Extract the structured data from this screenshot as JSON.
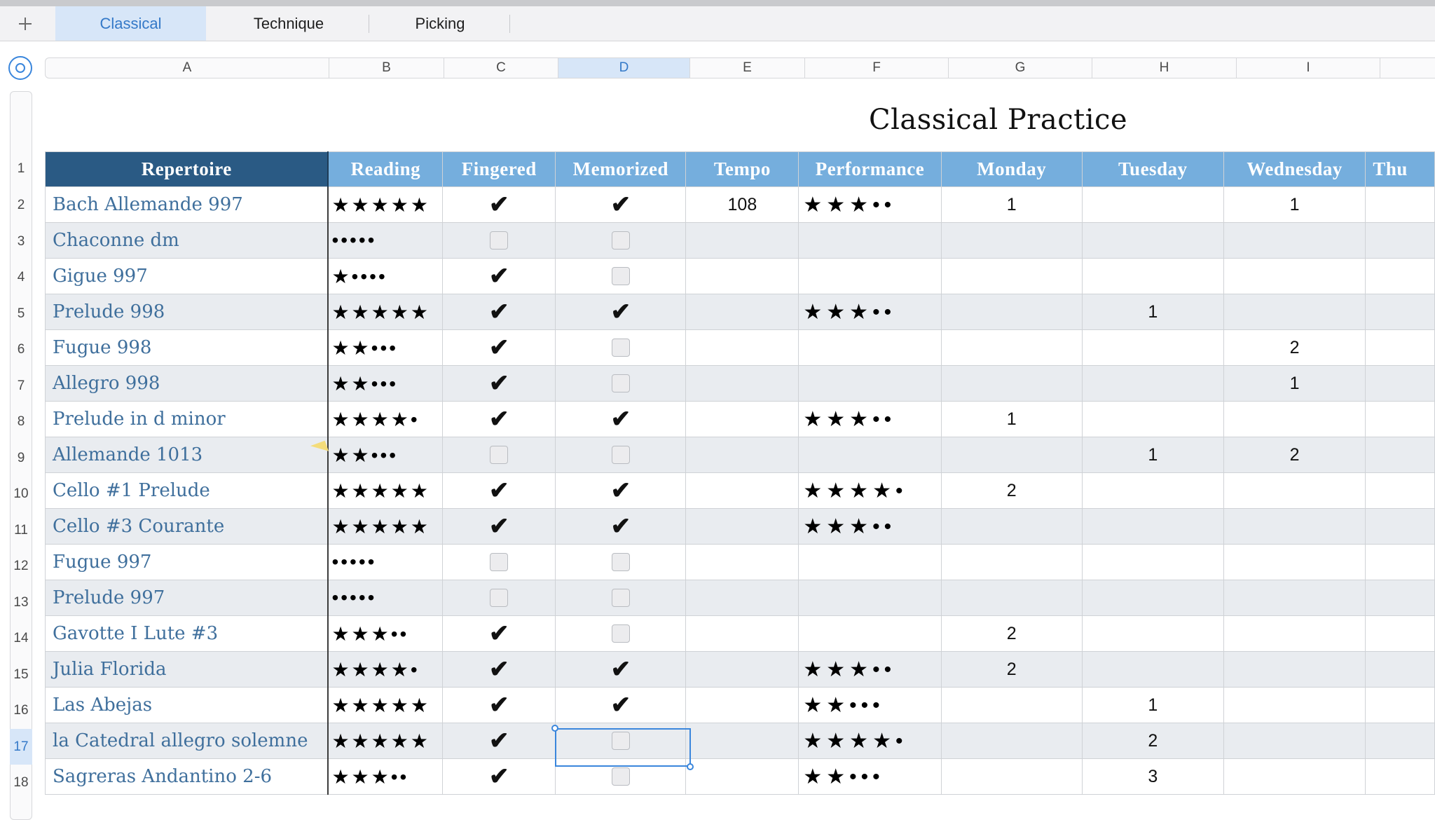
{
  "tabs": [
    {
      "label": "Classical",
      "active": true
    },
    {
      "label": "Technique",
      "active": false
    },
    {
      "label": "Picking",
      "active": false
    }
  ],
  "icons": {
    "add": "plus-icon",
    "select_all": "select-all-circle-icon"
  },
  "column_letters": [
    "A",
    "B",
    "C",
    "D",
    "E",
    "F",
    "G",
    "H",
    "I"
  ],
  "selected_column": "D",
  "row_numbers": [
    "1",
    "2",
    "3",
    "4",
    "5",
    "6",
    "7",
    "8",
    "9",
    "10",
    "11",
    "12",
    "13",
    "14",
    "15",
    "16",
    "17",
    "18"
  ],
  "selected_row": "17",
  "sheet_title": "Classical Practice",
  "table": {
    "headers": [
      "Repertoire",
      "Reading",
      "Fingered",
      "Memorized",
      "Tempo",
      "Performance",
      "Monday",
      "Tuesday",
      "Wednesday",
      "Thu"
    ],
    "rows": [
      {
        "name": "Bach Allemande 997",
        "reading": "★★★★★",
        "fingered": true,
        "memorized": true,
        "tempo": "108",
        "performance": "★★★••",
        "monday": "1",
        "tuesday": "",
        "wednesday": "1"
      },
      {
        "name": "Chaconne dm",
        "reading": "•••••",
        "fingered": false,
        "memorized": false,
        "tempo": "",
        "performance": "",
        "monday": "",
        "tuesday": "",
        "wednesday": ""
      },
      {
        "name": "Gigue 997",
        "reading": "★••••",
        "fingered": true,
        "memorized": false,
        "tempo": "",
        "performance": "",
        "monday": "",
        "tuesday": "",
        "wednesday": ""
      },
      {
        "name": "Prelude 998",
        "reading": "★★★★★",
        "fingered": true,
        "memorized": true,
        "tempo": "",
        "performance": "★★★••",
        "monday": "",
        "tuesday": "1",
        "wednesday": ""
      },
      {
        "name": "Fugue 998",
        "reading": "★★•••",
        "fingered": true,
        "memorized": false,
        "tempo": "",
        "performance": "",
        "monday": "",
        "tuesday": "",
        "wednesday": "2"
      },
      {
        "name": "Allegro 998",
        "reading": "★★•••",
        "fingered": true,
        "memorized": false,
        "tempo": "",
        "performance": "",
        "monday": "",
        "tuesday": "",
        "wednesday": "1"
      },
      {
        "name": "Prelude in d minor",
        "reading": "★★★★•",
        "fingered": true,
        "memorized": true,
        "tempo": "",
        "performance": "★★★••",
        "monday": "1",
        "tuesday": "",
        "wednesday": ""
      },
      {
        "name": "Allemande 1013",
        "reading": "★★•••",
        "fingered": false,
        "memorized": false,
        "tempo": "",
        "performance": "",
        "monday": "",
        "tuesday": "1",
        "wednesday": "2"
      },
      {
        "name": "Cello #1 Prelude",
        "reading": "★★★★★",
        "fingered": true,
        "memorized": true,
        "tempo": "",
        "performance": "★★★★•",
        "monday": "2",
        "tuesday": "",
        "wednesday": ""
      },
      {
        "name": "Cello #3 Courante",
        "reading": "★★★★★",
        "fingered": true,
        "memorized": true,
        "tempo": "",
        "performance": "★★★••",
        "monday": "",
        "tuesday": "",
        "wednesday": ""
      },
      {
        "name": "Fugue 997",
        "reading": "•••••",
        "fingered": false,
        "memorized": false,
        "tempo": "",
        "performance": "",
        "monday": "",
        "tuesday": "",
        "wednesday": ""
      },
      {
        "name": "Prelude 997",
        "reading": "•••••",
        "fingered": false,
        "memorized": false,
        "tempo": "",
        "performance": "",
        "monday": "",
        "tuesday": "",
        "wednesday": ""
      },
      {
        "name": "Gavotte I Lute #3",
        "reading": "★★★••",
        "fingered": true,
        "memorized": false,
        "tempo": "",
        "performance": "",
        "monday": "2",
        "tuesday": "",
        "wednesday": ""
      },
      {
        "name": "Julia Florida",
        "reading": "★★★★•",
        "fingered": true,
        "memorized": true,
        "tempo": "",
        "performance": "★★★••",
        "monday": "2",
        "tuesday": "",
        "wednesday": ""
      },
      {
        "name": "Las Abejas",
        "reading": "★★★★★",
        "fingered": true,
        "memorized": true,
        "tempo": "",
        "performance": "★★•••",
        "monday": "",
        "tuesday": "1",
        "wednesday": ""
      },
      {
        "name": "la Catedral allegro solemne",
        "reading": "★★★★★",
        "fingered": true,
        "memorized": false,
        "tempo": "",
        "performance": "★★★★•",
        "monday": "",
        "tuesday": "2",
        "wednesday": ""
      },
      {
        "name": "Sagreras Andantino 2-6",
        "reading": "★★★••",
        "fingered": true,
        "memorized": false,
        "tempo": "",
        "performance": "★★•••",
        "monday": "",
        "tuesday": "3",
        "wednesday": ""
      }
    ]
  }
}
